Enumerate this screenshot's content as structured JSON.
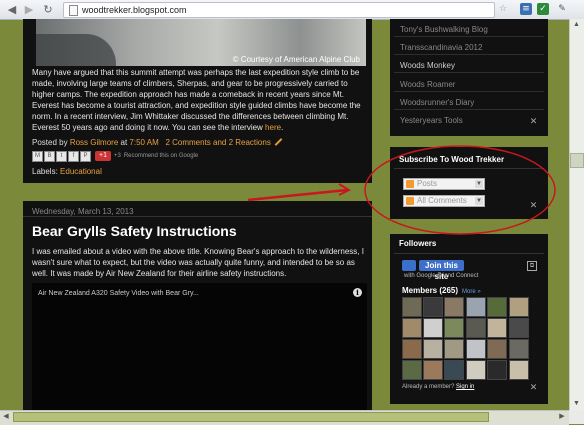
{
  "browser": {
    "url": "woodtrekker.blogspot.com",
    "back_icon": "back-arrow-icon",
    "forward_icon": "forward-arrow-icon",
    "reload_icon": "reload-icon"
  },
  "post1": {
    "photo_credit": "© Courtesy of American Alpine Club",
    "body": "Many have argued that this summit attempt was perhaps the last expedition style climb to be made, involving large teams of climbers, Sherpas, and gear to be progressively carried to higher camps. The expedition approach has made a comeback in recent years since Mt. Everest has become a tourist attraction, and expedition style guided climbs have become the norm. In a recent interview, Jim Whittaker discussed the differences between climbing Mt. Everest 50 years ago and doing it now. You can see the interview ",
    "body_link": "here",
    "body_end": ".",
    "posted_by": "Posted by",
    "author": "Ross Gilmore",
    "at": "at",
    "time": "7:50 AM",
    "comments": "2 Comments and 2 Reactions",
    "plus_count": "+3",
    "plus_label": "+1",
    "recommend": "Recommend this on Google",
    "labels_prefix": "Labels:",
    "label": "Educational"
  },
  "post2": {
    "date": "Wednesday, March 13, 2013",
    "title": "Bear Grylls Safety Instructions",
    "body": "I was emailed about a video with the above title. Knowing Bear's approach to the wilderness, I wasn't sure what to expect, but the video was actually quite funny, and intended to be so as well. It was made by Air New Zealand for their airline safety instructions.",
    "video_title": "Air New Zealand A320 Safety Video with Bear Gry..."
  },
  "sidebar": {
    "blogs": [
      "Tony's Bushwalking Blog",
      "Transscandinavia 2012",
      "Woods Monkey",
      "Woods Roamer",
      "Woodsrunner's Diary",
      "Yesteryears Tools"
    ],
    "subscribe_title": "Subscribe To Wood Trekker",
    "posts_label": "Posts",
    "comments_label": "All Comments",
    "followers_title": "Followers",
    "join_label": "Join this site",
    "gfc_text": "with Google Friend Connect",
    "members_label": "Members (265)",
    "more_label": "More »",
    "already_member": "Already a member?",
    "sign_in": "Sign in"
  },
  "colors": {
    "background": "#7b8a3a",
    "panel": "#111111",
    "link": "#e8a040",
    "annotation": "#c8171d"
  }
}
